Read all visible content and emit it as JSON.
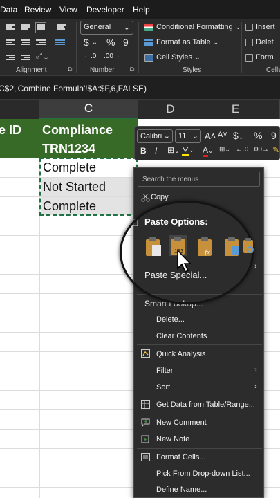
{
  "menubar": {
    "items": [
      "Data",
      "Review",
      "View",
      "Developer",
      "Help"
    ]
  },
  "ribbon": {
    "alignment_label": "Alignment",
    "number_label": "Number",
    "styles_label": "Styles",
    "cells_label": "Cells",
    "number_format": "General",
    "currency_symbol": "$",
    "percent_symbol": "%",
    "comma_symbol": "9",
    "conditional_formatting": "Conditional Formatting",
    "format_as_table": "Format as Table",
    "cell_styles": "Cell Styles",
    "insert": "Insert",
    "delete": "Delet",
    "format": "Form"
  },
  "formula_bar": {
    "text": "C$2,'Combine Formula'!$A:$F,6,FALSE)"
  },
  "columns": {
    "c": "C",
    "d": "D",
    "e": "E"
  },
  "sheet": {
    "header_left": "e ID",
    "header_c_line1": "Compliance",
    "header_c_line2": "TRN1234",
    "rows": [
      "Complete",
      "Not Started",
      "Complete"
    ]
  },
  "mini_toolbar": {
    "font": "Calibri",
    "size": "11",
    "grow": "A",
    "shrink": "A",
    "currency": "$",
    "percent": "%",
    "comma": "9",
    "bold": "B",
    "italic": "I",
    "font_color": "A"
  },
  "context_menu": {
    "search_placeholder": "Search the menus",
    "copy": "Copy",
    "paste_options": "Paste Options:",
    "paste_special": "Paste Special...",
    "smart_lookup": "Smart Lookup...",
    "delete": "Delete...",
    "clear_contents": "Clear Contents",
    "quick_analysis": "Quick Analysis",
    "filter": "Filter",
    "sort": "Sort",
    "get_data": "Get Data from Table/Range...",
    "new_comment": "New Comment",
    "new_note": "New Note",
    "format_cells": "Format Cells...",
    "pick_from_list": "Pick From Drop-down List...",
    "define_name": "Define Name..."
  },
  "colors": {
    "header_green": "#376a26",
    "accent_green": "#217346",
    "menu_bg": "#2c2c2c",
    "ribbon_bg": "#2b2b2b"
  }
}
